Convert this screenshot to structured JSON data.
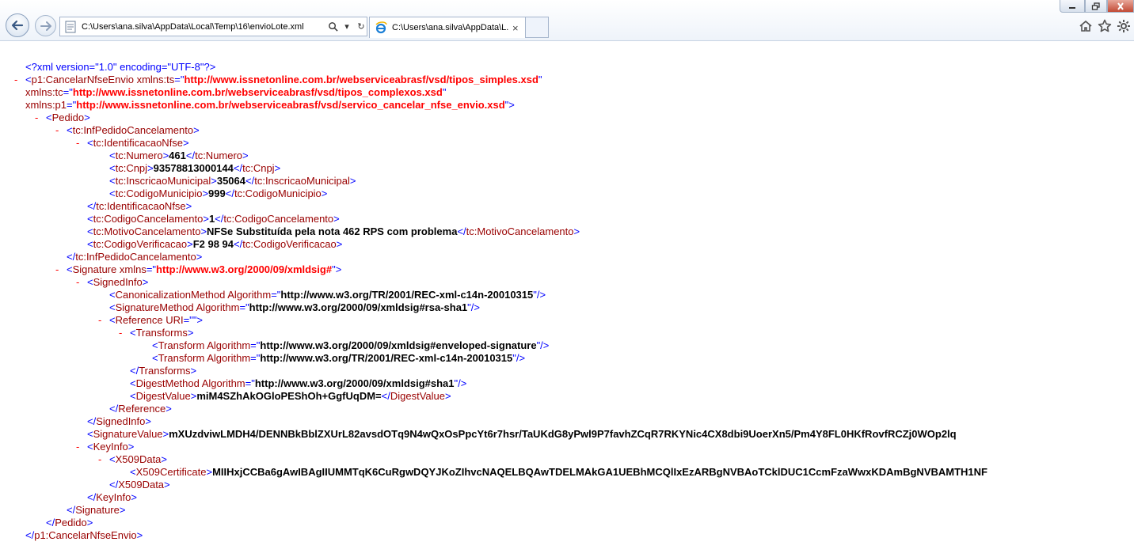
{
  "browser": {
    "address_url": "C:\\Users\\ana.silva\\AppData\\Local\\Temp\\16\\envioLote.xml",
    "tab_title": "C:\\Users\\ana.silva\\AppData\\L...",
    "tab_close": "×",
    "refresh_glyph": "↻",
    "dropdown_glyph": "▾"
  },
  "xml": {
    "pi": "<?xml version=\"1.0\" encoding=\"UTF-8\"?>",
    "expander": "-",
    "root_tag": "p1:CancelarNfseEnvio",
    "ns_ts_attr": "xmlns:ts",
    "ns_ts_val": "http://www.issnetonline.com.br/webserviceabrasf/vsd/tipos_simples.xsd",
    "ns_tc_attr": "xmlns:tc",
    "ns_tc_val": "http://www.issnetonline.com.br/webserviceabrasf/vsd/tipos_complexos.xsd",
    "ns_p1_attr": "xmlns:p1",
    "ns_p1_val": "http://www.issnetonline.com.br/webserviceabrasf/vsd/servico_cancelar_nfse_envio.xsd",
    "pedido_tag": "Pedido",
    "inf_tag": "tc:InfPedidoCancelamento",
    "ident_tag": "tc:IdentificacaoNfse",
    "numero_tag": "tc:Numero",
    "numero_val": "461",
    "cnpj_tag": "tc:Cnpj",
    "cnpj_val": "93578813000144",
    "im_tag": "tc:InscricaoMunicipal",
    "im_val": "35064",
    "codmun_tag": "tc:CodigoMunicipio",
    "codmun_val": "999",
    "codcanc_tag": "tc:CodigoCancelamento",
    "codcanc_val": "1",
    "motivo_tag": "tc:MotivoCancelamento",
    "motivo_val": "NFSe Substituída pela nota 462 RPS com problema",
    "codver_tag": "tc:CodigoVerificacao",
    "codver_val": "F2 98 94",
    "sig_tag": "Signature",
    "xmlns_attr": "xmlns",
    "sig_ns_val": "http://www.w3.org/2000/09/xmldsig#",
    "signedinfo_tag": "SignedInfo",
    "canon_tag": "CanonicalizationMethod",
    "algorithm_attr": "Algorithm",
    "canon_val": "http://www.w3.org/TR/2001/REC-xml-c14n-20010315",
    "sigmethod_tag": "SignatureMethod",
    "sigmethod_val": "http://www.w3.org/2000/09/xmldsig#rsa-sha1",
    "reference_tag": "Reference",
    "uri_attr": "URI",
    "uri_val": "",
    "transforms_tag": "Transforms",
    "transform_tag": "Transform",
    "transform1_val": "http://www.w3.org/2000/09/xmldsig#enveloped-signature",
    "transform2_val": "http://www.w3.org/TR/2001/REC-xml-c14n-20010315",
    "digestmethod_tag": "DigestMethod",
    "digestmethod_val": "http://www.w3.org/2000/09/xmldsig#sha1",
    "digestvalue_tag": "DigestValue",
    "digestvalue_val": "miM4SZhAkOGloPEShOh+GgfUqDM=",
    "sigvalue_tag": "SignatureValue",
    "sigvalue_val": "mXUzdviwLMDH4/DENNBkBblZXUrL82avsdOTq9N4wQxOsPpcYt6r7hsr/TaUKdG8yPwl9P7favhZCqR7RKYNic4CX8dbi9UoerXn5/Pm4Y8FL0HKfRovfRCZj0WOp2lq",
    "keyinfo_tag": "KeyInfo",
    "x509data_tag": "X509Data",
    "x509cert_tag": "X509Certificate",
    "x509cert_val": "MIIHxjCCBa6gAwIBAgIIUMMTqK6CuRgwDQYJKoZIhvcNAQELBQAwTDELMAkGA1UEBhMCQlIxEzARBgNVBAoTCklDUC1CcmFzaWwxKDAmBgNVBAMTH1NF"
  }
}
